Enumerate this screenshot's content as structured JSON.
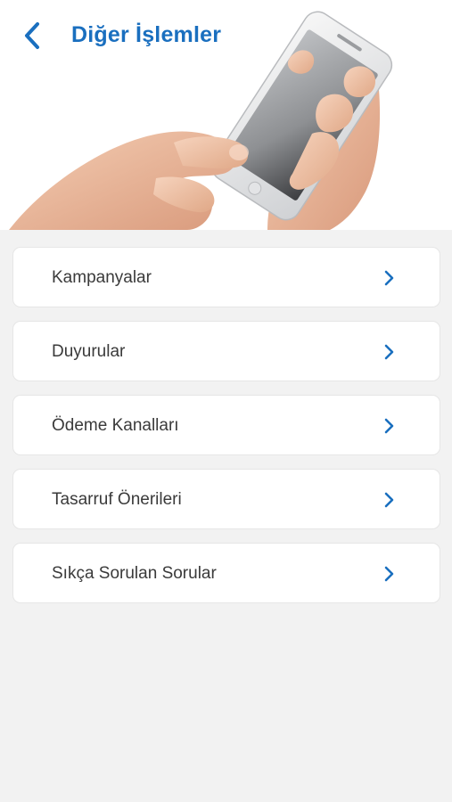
{
  "header": {
    "title": "Diğer İşlemler",
    "back_icon": "chevron-left-icon",
    "accent_color": "#1a6fbf",
    "image": "hands-holding-smartphone"
  },
  "menu": {
    "items": [
      {
        "label": "Kampanyalar",
        "icon": "chevron-right-icon"
      },
      {
        "label": "Duyurular",
        "icon": "chevron-right-icon"
      },
      {
        "label": "Ödeme Kanalları",
        "icon": "chevron-right-icon"
      },
      {
        "label": "Tasarruf Önerileri",
        "icon": "chevron-right-icon"
      },
      {
        "label": "Sıkça Sorulan Sorular",
        "icon": "chevron-right-icon"
      }
    ]
  }
}
